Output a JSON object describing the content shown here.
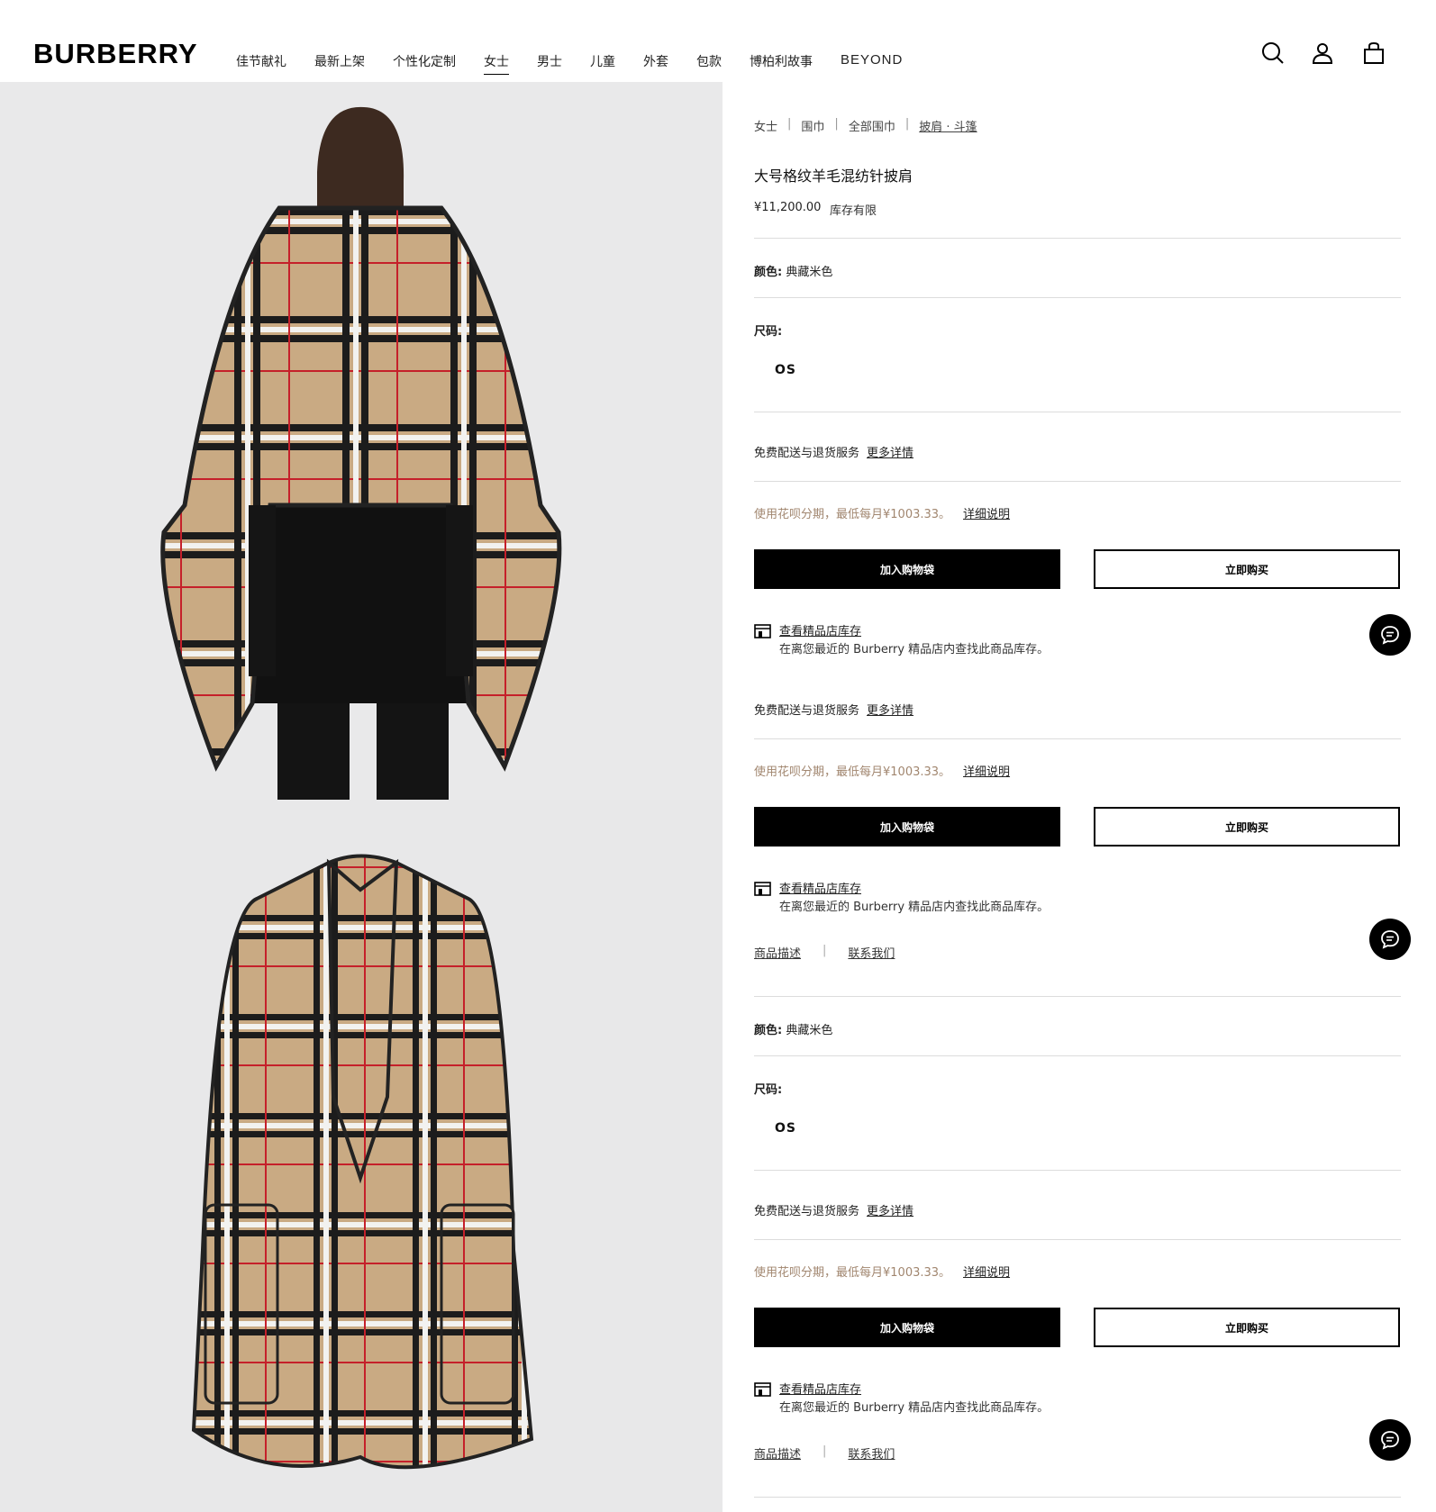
{
  "header": {
    "logo": "BURBERRY",
    "nav": [
      "佳节献礼",
      "最新上架",
      "个性化定制",
      "女士",
      "男士",
      "儿童",
      "外套",
      "包款",
      "博柏利故事",
      "BEYOND"
    ],
    "active_nav": "女士",
    "icons": [
      "search-icon",
      "account-icon",
      "bag-icon"
    ]
  },
  "breadcrumb": [
    "女士",
    "围巾",
    "全部围巾",
    "披肩 · 斗篷"
  ],
  "product": {
    "title": "大号格纹羊毛混纺针披肩",
    "price": "¥11,200.00",
    "stock": "库存有限"
  },
  "color": {
    "label": "颜色:",
    "value": "典藏米色"
  },
  "size": {
    "label": "尺码:",
    "value": "OS"
  },
  "shipping": {
    "text": "免费配送与退货服务",
    "link": "更多详情"
  },
  "installment": {
    "text": "使用花呗分期，最低每月¥1003.33。",
    "link": "详细说明"
  },
  "buttons": {
    "add_to_bag": "加入购物袋",
    "buy_now": "立即购买"
  },
  "store": {
    "title": "查看精品店库存",
    "desc": "在离您最近的 Burberry 精品店内查找此商品库存。"
  },
  "footer_links": {
    "description": "商品描述",
    "contact": "联系我们"
  },
  "colors": {
    "installment": "#a1866f",
    "black": "#000000",
    "camel": "#c9aa83"
  }
}
